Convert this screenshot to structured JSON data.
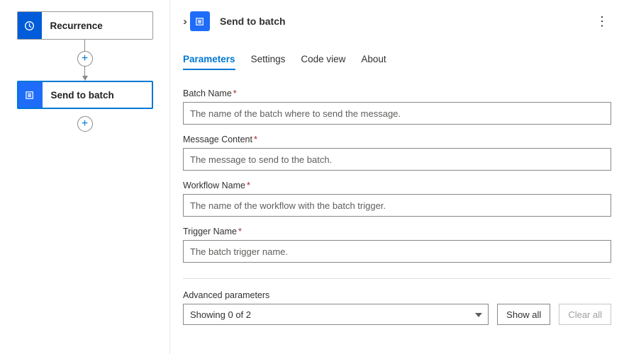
{
  "canvas": {
    "nodes": [
      {
        "label": "Recurrence",
        "icon": "clock-icon"
      },
      {
        "label": "Send to batch",
        "icon": "batch-icon"
      }
    ]
  },
  "panel": {
    "title": "Send to batch",
    "tabs": {
      "parameters": "Parameters",
      "settings": "Settings",
      "code_view": "Code view",
      "about": "About",
      "active": "parameters"
    },
    "fields": {
      "batch_name": {
        "label": "Batch Name",
        "required": true,
        "placeholder": "The name of the batch where to send the message."
      },
      "message_content": {
        "label": "Message Content",
        "required": true,
        "placeholder": "The message to send to the batch."
      },
      "workflow_name": {
        "label": "Workflow Name",
        "required": true,
        "placeholder": "The name of the workflow with the batch trigger."
      },
      "trigger_name": {
        "label": "Trigger Name",
        "required": true,
        "placeholder": "The batch trigger name."
      }
    },
    "advanced": {
      "label": "Advanced parameters",
      "selected": "Showing 0 of 2",
      "show_all": "Show all",
      "clear_all": "Clear all"
    }
  }
}
